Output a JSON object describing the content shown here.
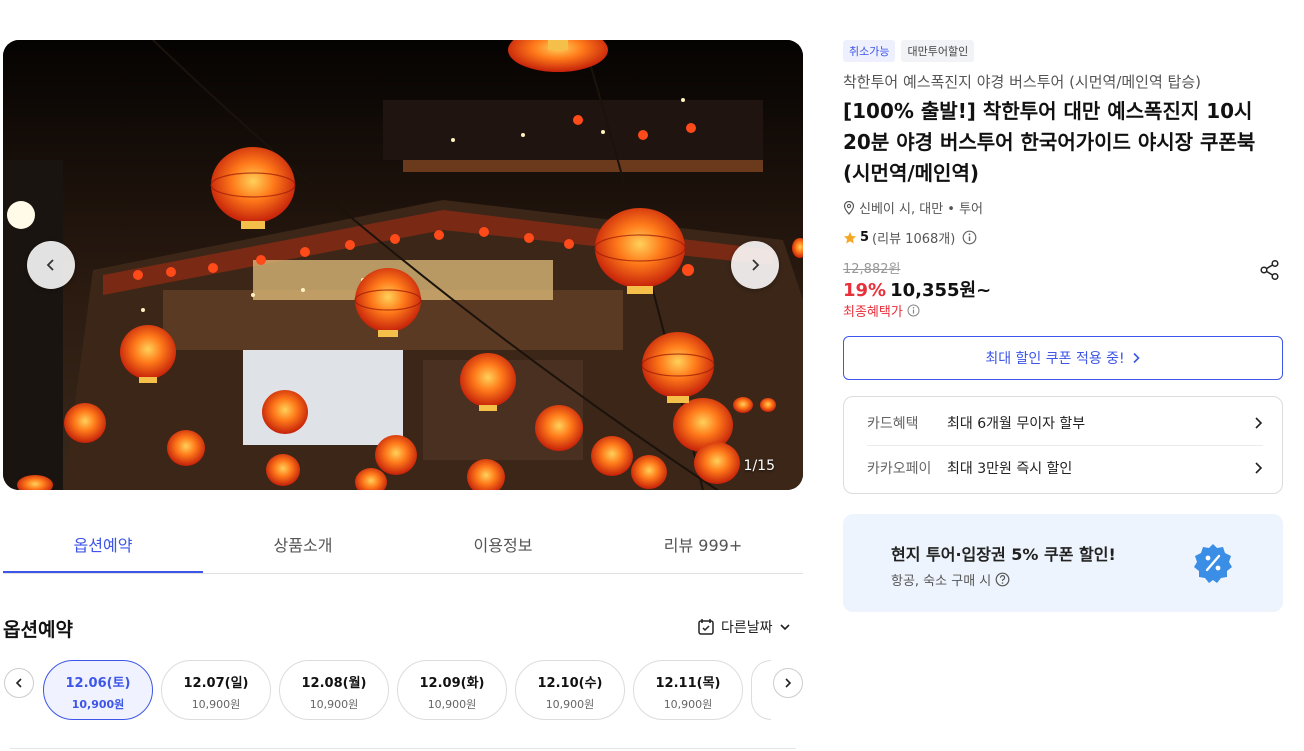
{
  "gallery": {
    "counter": "1/15"
  },
  "tabs": [
    {
      "label": "옵션예약"
    },
    {
      "label": "상품소개"
    },
    {
      "label": "이용정보"
    },
    {
      "label": "리뷰 999+"
    }
  ],
  "options": {
    "title": "옵션예약",
    "other_date": "다른날짜",
    "dates": [
      {
        "date": "12.06(토)",
        "price": "10,900원"
      },
      {
        "date": "12.07(일)",
        "price": "10,900원"
      },
      {
        "date": "12.08(월)",
        "price": "10,900원"
      },
      {
        "date": "12.09(화)",
        "price": "10,900원"
      },
      {
        "date": "12.10(수)",
        "price": "10,900원"
      },
      {
        "date": "12.11(목)",
        "price": "10,900원"
      }
    ]
  },
  "product": {
    "badges": [
      "취소가능",
      "대만투어할인"
    ],
    "subtitle": "착한투어 예스폭진지 야경 버스투어 (시먼역/메인역 탑승)",
    "title": "[100% 출발!] 착한투어 대만 예스폭진지 10시 20분 야경 버스투어 한국어가이드 야시장 쿠폰북 (시먼역/메인역)",
    "location": "신베이 시,  대만 • 투어",
    "rating": "5",
    "reviews": "(리뷰 1068개)",
    "original_price": "12,882원",
    "discount": "19%",
    "price": "10,355원~",
    "final_benefit": "최종혜택가"
  },
  "coupon_button": "최대 할인 쿠폰 적용 중!",
  "benefits": [
    {
      "key": "카드혜택",
      "value": "최대 6개월 무이자 할부"
    },
    {
      "key": "카카오페이",
      "value": "최대 3만원 즉시 할인"
    }
  ],
  "promo": {
    "title": "현지 투어·입장권 5% 쿠폰 할인!",
    "subtitle": "항공, 숙소 구매 시"
  },
  "colors": {
    "accent": "#3d55e8",
    "discount": "#e8303b",
    "star": "#f5a623",
    "promo_bg": "#eef4fd"
  }
}
